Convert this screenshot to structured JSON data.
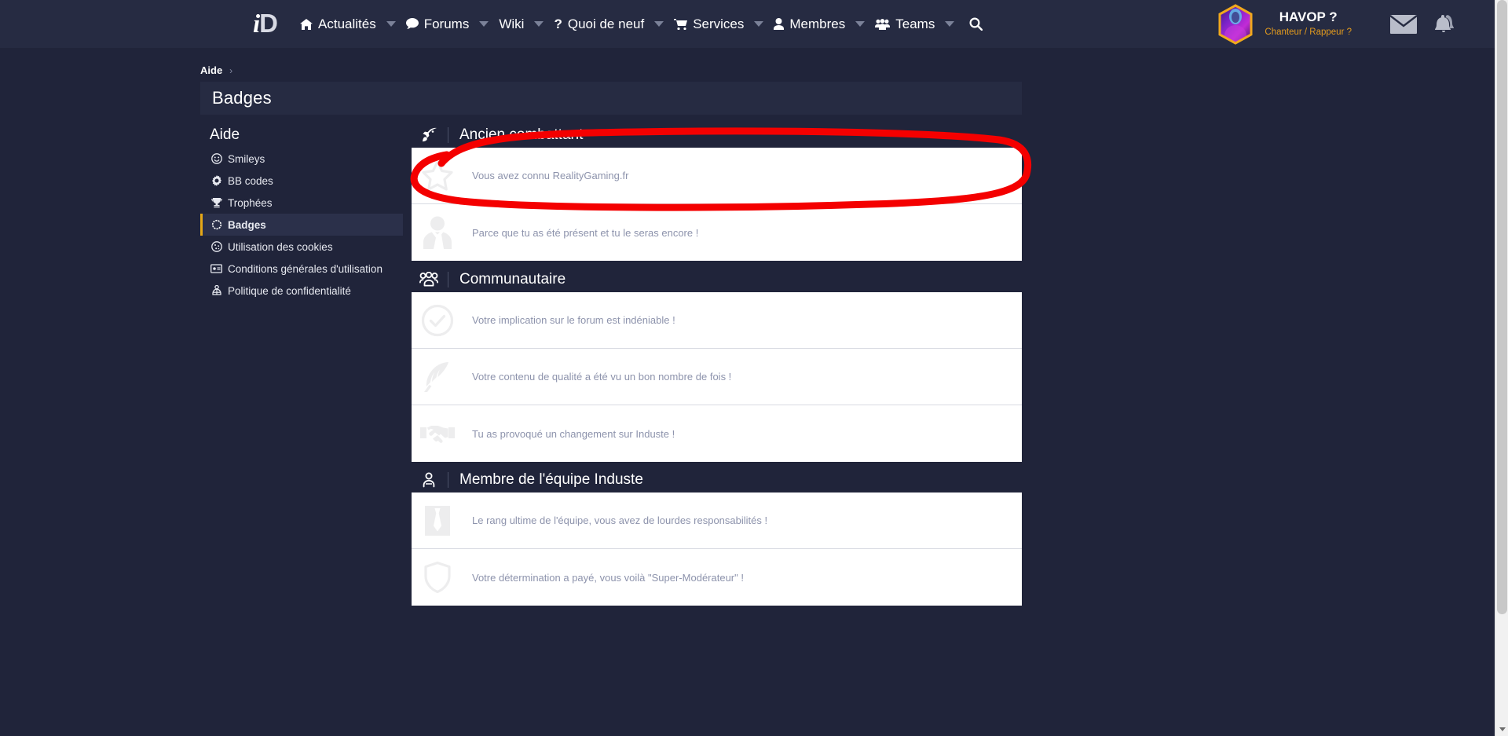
{
  "navbar": {
    "brand": {
      "part1": "i",
      "part2": "D"
    },
    "items": [
      {
        "label": "Actualités",
        "icon": "home-icon",
        "caret": true
      },
      {
        "label": "Forums",
        "icon": "comment-icon",
        "caret": true
      },
      {
        "label": "Wiki",
        "icon": "",
        "caret": true
      },
      {
        "label": "Quoi de neuf",
        "icon": "question-icon",
        "caret": true
      },
      {
        "label": "Services",
        "icon": "cart-icon",
        "caret": true
      },
      {
        "label": "Membres",
        "icon": "user-icon",
        "caret": true
      },
      {
        "label": "Teams",
        "icon": "users-icon",
        "caret": true
      }
    ],
    "search_icon": "search-icon",
    "user": {
      "name": "HAVOP ?",
      "role": "Chanteur / Rappeur ?",
      "avatar_alt": "avatar",
      "inbox_icon": "envelope-icon",
      "alerts_icon": "bell-icon"
    }
  },
  "breadcrumb": {
    "root": "Aide",
    "separator": "›"
  },
  "page": {
    "title": "Badges"
  },
  "sidebar": {
    "heading": "Aide",
    "items": [
      {
        "label": "Smileys",
        "icon": "smiley-icon",
        "active": false
      },
      {
        "label": "BB codes",
        "icon": "gear-icon",
        "active": false
      },
      {
        "label": "Trophées",
        "icon": "trophy-icon",
        "active": false
      },
      {
        "label": "Badges",
        "icon": "badge-icon",
        "active": true
      },
      {
        "label": "Utilisation des cookies",
        "icon": "cookie-icon",
        "active": false
      },
      {
        "label": "Conditions générales d'utilisation",
        "icon": "contract-icon",
        "active": false
      },
      {
        "label": "Politique de confidentialité",
        "icon": "privacy-icon",
        "active": false
      }
    ]
  },
  "groups": [
    {
      "title": "Ancien combattant",
      "icon": "rocket-icon",
      "badges": [
        {
          "icon": "star-icon",
          "desc": "Vous avez connu RealityGaming.fr"
        },
        {
          "icon": "person-tie-icon",
          "desc": "Parce que tu as été présent et tu le seras encore !"
        }
      ]
    },
    {
      "title": "Communautaire",
      "icon": "users-group-icon",
      "badges": [
        {
          "icon": "check-circle-icon",
          "desc": "Votre implication sur le forum est indéniable !"
        },
        {
          "icon": "feather-icon",
          "desc": "Votre contenu de qualité a été vu un bon nombre de fois !"
        },
        {
          "icon": "handshake-icon",
          "desc": "Tu as provoqué un changement sur Induste !"
        }
      ]
    },
    {
      "title": "Membre de l'équipe Induste",
      "icon": "person-icon",
      "badges": [
        {
          "icon": "tie-icon",
          "desc": "Le rang ultime de l'équipe, vous avez de lourdes responsabilités !"
        },
        {
          "icon": "shield-icon",
          "desc": "Votre détermination a payé, vous voilà \"Super-Modérateur\" !"
        }
      ]
    }
  ],
  "annotation": {
    "shape": "ellipse",
    "color": "#f40000"
  },
  "colors": {
    "page_bg": "#20243a",
    "nav_bg": "#262b42",
    "accent": "#e6a817",
    "role_text": "#e39b1e",
    "badge_desc": "#8d93ac"
  }
}
